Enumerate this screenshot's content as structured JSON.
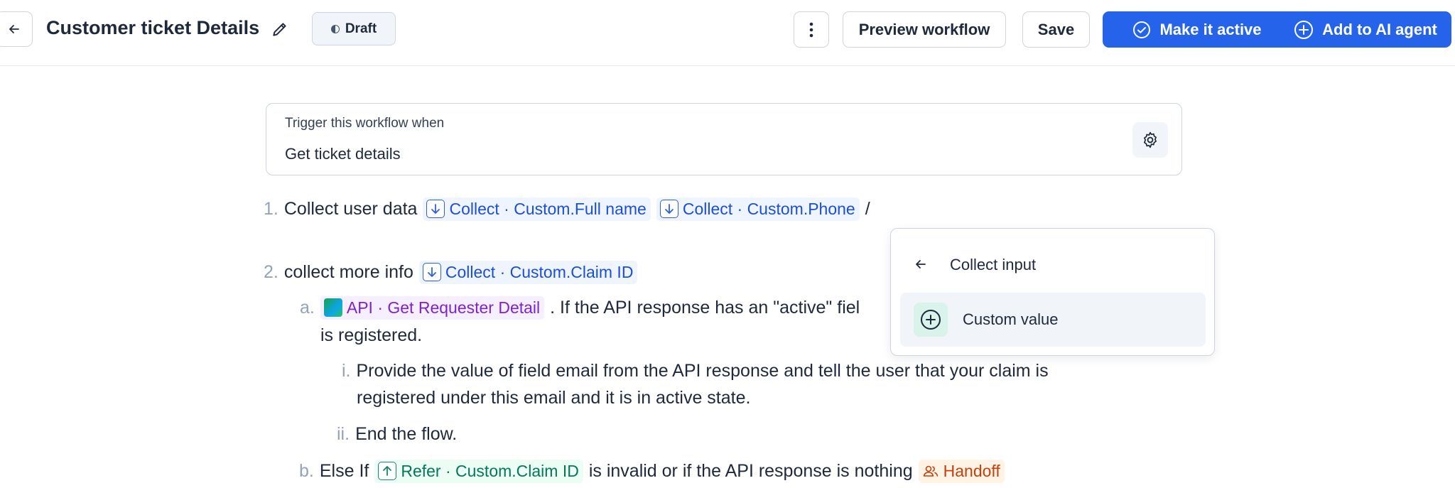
{
  "header": {
    "title": "Customer ticket Details",
    "status_badge": "Draft",
    "more_icon": "more-vertical-icon",
    "preview_label": "Preview workflow",
    "save_label": "Save",
    "make_active_label": "Make it active",
    "add_ai_label": "Add to AI agent"
  },
  "trigger": {
    "label": "Trigger this workflow when",
    "value": "Get ticket details"
  },
  "steps": {
    "s1": {
      "num": "1.",
      "text": "Collect user data",
      "chip1": "Collect · Custom.Full name",
      "chip2": "Collect · Custom.Phone",
      "slash": "/"
    },
    "s2": {
      "num": "2.",
      "text": "collect more info",
      "chip": "Collect · Custom.Claim ID"
    },
    "s2a": {
      "num": "a.",
      "chip": "API · Get Requester Detail",
      "text": ". If the API response has an \"active\" fiel",
      "cont": "is registered."
    },
    "s2ai": {
      "num": "i.",
      "line1": "Provide the value of field email from the API response and tell the user that your claim is",
      "line2": "registered under this email and it is in active state."
    },
    "s2aii": {
      "num": "ii.",
      "text": "End the flow."
    },
    "s2b": {
      "num": "b.",
      "prefix": "Else If",
      "chip": "Refer · Custom.Claim ID",
      "text": "is invalid or if the API response is nothing",
      "handoff": "Handoff"
    }
  },
  "popup": {
    "title": "Collect input",
    "item_label": "Custom value"
  },
  "colors": {
    "primary": "#2563eb",
    "collect_chip": "#1d4ed8",
    "api_chip": "#7e22ce",
    "refer_chip": "#047857",
    "handoff_chip": "#c2410c"
  }
}
